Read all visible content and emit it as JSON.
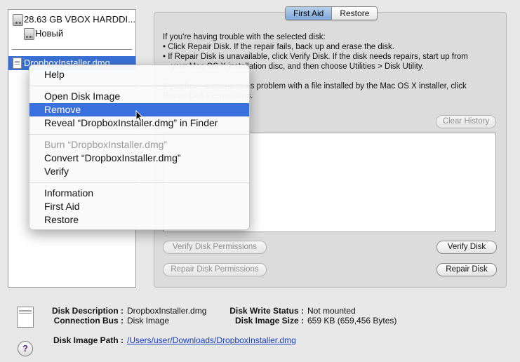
{
  "sidebar": {
    "items": [
      {
        "label": "28.63 GB VBOX HARDDI...",
        "icon": "hard-disk-icon"
      },
      {
        "label": "Новый",
        "icon": "volume-icon"
      },
      {
        "label": "DropboxInstaller.dmg",
        "icon": "disk-image-icon",
        "selected": true
      }
    ]
  },
  "tabs": {
    "first_aid": "First Aid",
    "restore": "Restore"
  },
  "intro": {
    "line1": "If you're having trouble with the selected disk:",
    "line2": "• Click Repair Disk. If the repair fails, back up and erase the disk.",
    "line3": "• If Repair Disk is unavailable, click Verify Disk. If the disk needs repairs, start up from",
    "line4": "your Mac OS X installation disc, and then choose Utilities > Disk Utility.",
    "line5": "If you have a permissions problem with a file installed by the Mac OS X installer, click",
    "line6": "Repair Disk Permissions."
  },
  "buttons": {
    "clear_history": "Clear History",
    "verify_permissions": "Verify Disk Permissions",
    "verify_disk": "Verify Disk",
    "repair_permissions": "Repair Disk Permissions",
    "repair_disk": "Repair Disk"
  },
  "info": {
    "disk_description_label": "Disk Description :",
    "disk_description": "DropboxInstaller.dmg",
    "connection_bus_label": "Connection Bus :",
    "connection_bus": "Disk Image",
    "write_status_label": "Disk Write Status :",
    "write_status": "Not mounted",
    "image_size_label": "Disk Image Size :",
    "image_size": "659 KB (659,456 Bytes)",
    "image_path_label": "Disk Image Path :",
    "image_path": "/Users/user/Downloads/DropboxInstaller.dmg"
  },
  "help_label": "?",
  "context_menu": {
    "items": [
      {
        "label": "Help"
      },
      {
        "label": "Open Disk Image"
      },
      {
        "label": "Remove",
        "selected": true
      },
      {
        "label": "Reveal “DropboxInstaller.dmg” in Finder"
      },
      {
        "label": "Burn “DropboxInstaller.dmg”",
        "disabled": true
      },
      {
        "label": "Convert “DropboxInstaller.dmg”"
      },
      {
        "label": "Verify"
      },
      {
        "label": "Information"
      },
      {
        "label": "First Aid"
      },
      {
        "label": "Restore"
      }
    ]
  },
  "colors": {
    "selection": "#3a6fde",
    "link": "#1a3fc0"
  }
}
